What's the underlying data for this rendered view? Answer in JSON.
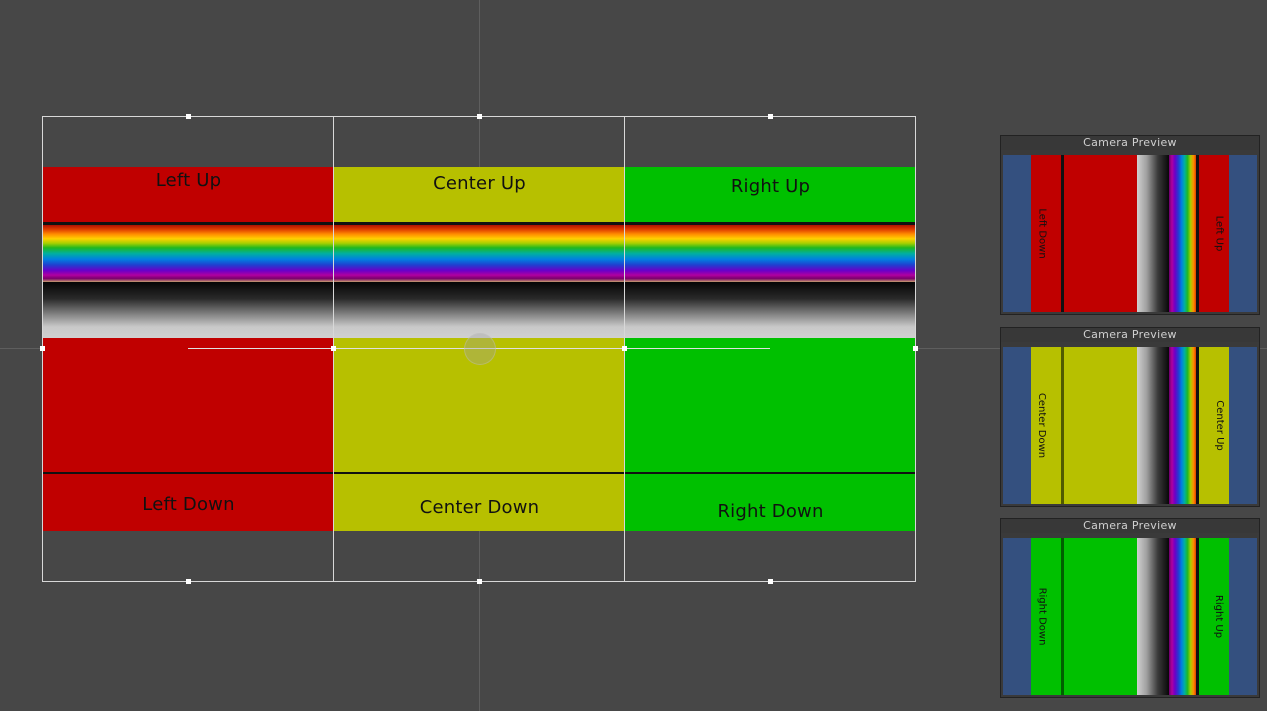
{
  "scene": {
    "panels": [
      {
        "key": "left",
        "color": "red",
        "top_label": "Left Up",
        "bottom_label": "Left Down"
      },
      {
        "key": "center",
        "color": "yellow",
        "top_label": "Center Up",
        "bottom_label": "Center Down"
      },
      {
        "key": "right",
        "color": "green",
        "top_label": "Right Up",
        "bottom_label": "Right Down"
      }
    ]
  },
  "colors": {
    "scene_background": "#474747",
    "red": "#c00000",
    "yellow": "#b7c000",
    "green": "#00c000",
    "camera_background": "#34507f"
  },
  "camera_previews": [
    {
      "title": "Camera Preview",
      "color": "red",
      "left_label": "Left Down",
      "right_label": "Left Up"
    },
    {
      "title": "Camera Preview",
      "color": "yellow",
      "left_label": "Center Down",
      "right_label": "Center Up"
    },
    {
      "title": "Camera Preview",
      "color": "green",
      "left_label": "Right Down",
      "right_label": "Right Up"
    }
  ]
}
